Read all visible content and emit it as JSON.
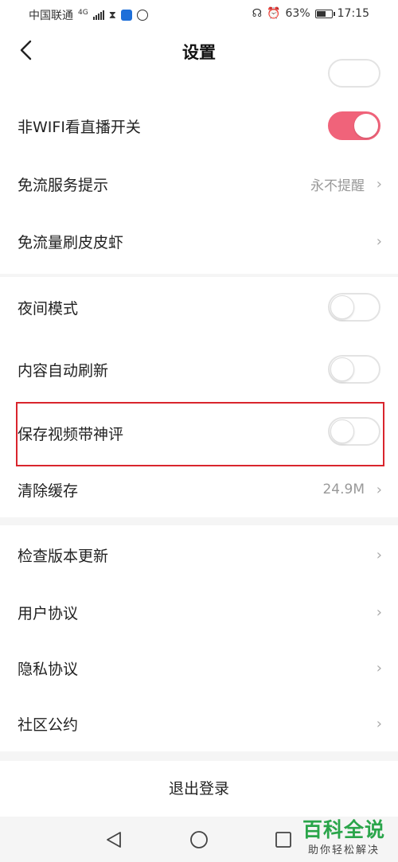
{
  "status_bar": {
    "carrier": "中国联通",
    "network": "4G",
    "battery": "63%",
    "battery_level": 0.63,
    "time": "17:15"
  },
  "header": {
    "title": "设置"
  },
  "settings": {
    "live_non_wifi": {
      "label": "非WIFI看直播开关",
      "on": true
    },
    "free_traffic_tip": {
      "label": "免流服务提示",
      "value": "永不提醒"
    },
    "free_traffic_skin": {
      "label": "免流量刷皮皮虾"
    },
    "night_mode": {
      "label": "夜间模式",
      "on": false
    },
    "auto_refresh": {
      "label": "内容自动刷新",
      "on": false
    },
    "save_video_comment": {
      "label": "保存视频带神评",
      "on": false
    },
    "clear_cache": {
      "label": "清除缓存",
      "value": "24.9M"
    },
    "check_update": {
      "label": "检查版本更新"
    },
    "user_agreement": {
      "label": "用户协议"
    },
    "privacy_agreement": {
      "label": "隐私协议"
    },
    "community_rules": {
      "label": "社区公约"
    }
  },
  "logout": {
    "label": "退出登录"
  },
  "watermark": {
    "title": "百科全说",
    "subtitle": "助你轻松解决"
  },
  "colors": {
    "accent": "#f0637a",
    "highlight_border": "#d9252d",
    "watermark": "#2aa54a"
  }
}
